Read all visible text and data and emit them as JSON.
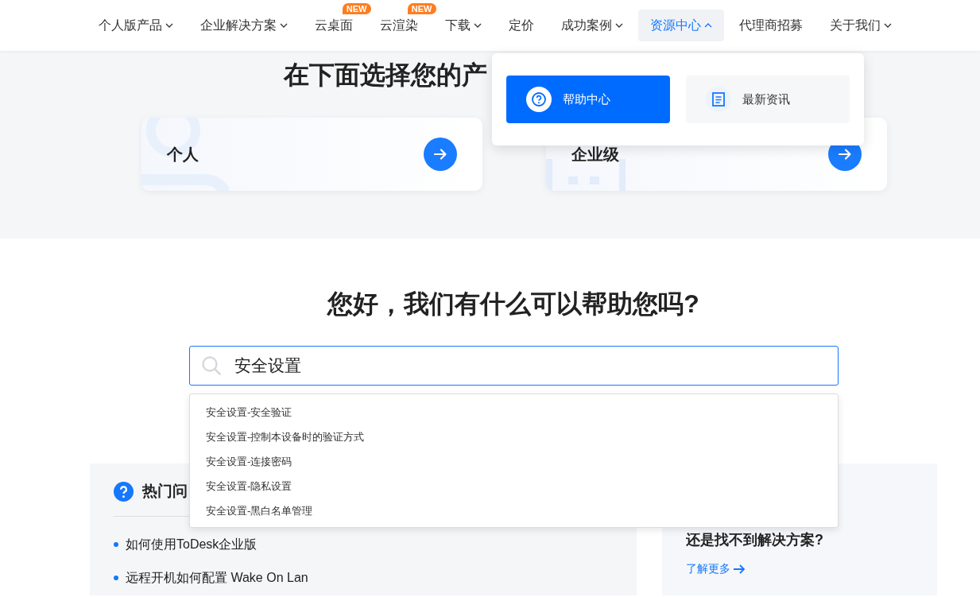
{
  "nav": {
    "items": [
      {
        "label": "个人版产品",
        "has_menu": true,
        "expanded": false,
        "selected": false
      },
      {
        "label": "企业解决方案",
        "has_menu": true,
        "expanded": false,
        "selected": false
      },
      {
        "label": "云桌面",
        "has_menu": false,
        "selected": false,
        "badge": "NEW"
      },
      {
        "label": "云渲染",
        "has_menu": false,
        "selected": false,
        "badge": "NEW"
      },
      {
        "label": "下载",
        "has_menu": true,
        "expanded": false,
        "selected": false
      },
      {
        "label": "定价",
        "has_menu": false,
        "selected": false
      },
      {
        "label": "成功案例",
        "has_menu": true,
        "expanded": false,
        "selected": false
      },
      {
        "label": "资源中心",
        "has_menu": true,
        "expanded": true,
        "selected": true
      },
      {
        "label": "代理商招募",
        "has_menu": false,
        "selected": false
      },
      {
        "label": "关于我们",
        "has_menu": true,
        "expanded": false,
        "selected": false
      }
    ]
  },
  "resource_menu": {
    "items": [
      {
        "label": "帮助中心",
        "kind": "help",
        "selected": true
      },
      {
        "label": "最新资讯",
        "kind": "news",
        "selected": false
      }
    ]
  },
  "product_chooser": {
    "title": "在下面选择您的产",
    "cards": [
      {
        "label": "个人",
        "kind": "personal"
      },
      {
        "label": "企业级",
        "kind": "enterprise"
      }
    ]
  },
  "help": {
    "title": "您好，我们有什么可以帮助您吗?",
    "search": {
      "value": "安全设置"
    },
    "suggestions": [
      "安全设置-安全验证",
      "安全设置-控制本设备时的验证方式",
      "安全设置-连接密码",
      "安全设置-隐私设置",
      "安全设置-黑白名单管理"
    ]
  },
  "hot_questions": {
    "title": "热门问",
    "items": [
      "如何使用ToDesk企业版",
      "远程开机如何配置 Wake On Lan"
    ]
  },
  "more_help": {
    "title": "还是找不到解决方案?",
    "link": "了解更多"
  }
}
